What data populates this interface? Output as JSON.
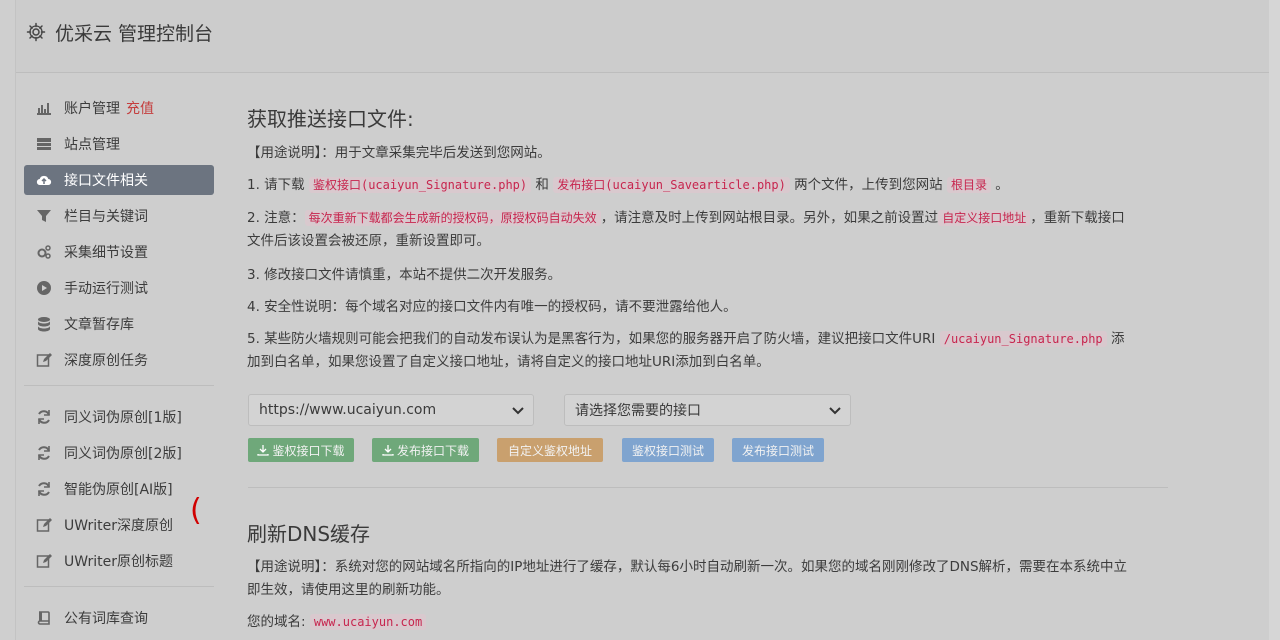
{
  "app": {
    "title": "优采云 管理控制台"
  },
  "sidebar": {
    "items": [
      {
        "label": "账户管理",
        "badge": "充值",
        "icon": "bar-chart-icon"
      },
      {
        "label": "站点管理",
        "icon": "server-icon"
      },
      {
        "label": "接口文件相关",
        "icon": "cloud-upload-icon",
        "active": true
      },
      {
        "label": "栏目与关键词",
        "icon": "filter-icon"
      },
      {
        "label": "采集细节设置",
        "icon": "cogs-icon"
      },
      {
        "label": "手动运行测试",
        "icon": "play-circle-icon"
      },
      {
        "label": "文章暂存库",
        "icon": "database-icon"
      },
      {
        "label": "深度原创任务",
        "icon": "edit-icon"
      }
    ],
    "items2": [
      {
        "label": "同义词伪原创[1版]",
        "icon": "refresh-icon"
      },
      {
        "label": "同义词伪原创[2版]",
        "icon": "refresh-icon"
      },
      {
        "label": "智能伪原创[AI版]",
        "icon": "refresh-icon"
      },
      {
        "label": "UWriter深度原创",
        "icon": "edit-icon"
      },
      {
        "label": "UWriter原创标题",
        "icon": "edit-icon"
      }
    ],
    "items3": [
      {
        "label": "公有词库查询",
        "icon": "book-icon"
      }
    ]
  },
  "section1": {
    "title": "获取推送接口文件:",
    "usage": "【用途说明】：用于文章采集完毕后发送到您网站。",
    "p1": {
      "a": "1. 请下载 ",
      "code1": "鉴权接口(ucaiyun_Signature.php)",
      "b": " 和 ",
      "code2": "发布接口(ucaiyun_Savearticle.php)",
      "c": " 两个文件，上传到您网站 ",
      "code3": "根目录",
      "d": " 。"
    },
    "p2": {
      "a": "2. 注意：",
      "code1": "每次重新下载都会生成新的授权码，原授权码自动失效",
      "b": "，请注意及时上传到网站根目录。另外，如果之前设置过",
      "code2": "自定义接口地址",
      "c": "，重新下载接口文件后该设置会被还原，重新设置即可。"
    },
    "p3": "3. 修改接口文件请慎重，本站不提供二次开发服务。",
    "p4": "4. 安全性说明：每个域名对应的接口文件内有唯一的授权码，请不要泄露给他人。",
    "p5": {
      "a": "5. 某些防火墙规则可能会把我们的自动发布误认为是黑客行为，如果您的服务器开启了防火墙，建议把接口文件URI ",
      "code1": "/ucaiyun_Signature.php",
      "b": " 添加到白名单，如果您设置了自定义接口地址，请将自定义的接口地址URI添加到白名单。"
    },
    "site_select": "https://www.ucaiyun.com",
    "api_select": "请选择您需要的接口",
    "buttons": {
      "auth_download": "鉴权接口下载",
      "publish_download": "发布接口下载",
      "custom_auth_url": "自定义鉴权地址",
      "auth_test": "鉴权接口测试",
      "publish_test": "发布接口测试"
    }
  },
  "section2": {
    "title": "刷新DNS缓存",
    "usage": "【用途说明】：系统对您的网站域名所指向的IP地址进行了缓存，默认每6小时自动刷新一次。如果您的域名刚刚修改了DNS解析，需要在本系统中立即生效，请使用这里的刷新功能。",
    "domain_label": "您的域名:",
    "domain_value": "www.ucaiyun.com"
  },
  "annotation": {
    "mark": "("
  },
  "colors": {
    "active_nav": "#6c7480",
    "badge_red": "#c43d3d",
    "btn_green": "#6fa87a",
    "btn_orange": "#c9a06e",
    "btn_blue": "#7fa4cf",
    "code_red": "#c7254e"
  }
}
